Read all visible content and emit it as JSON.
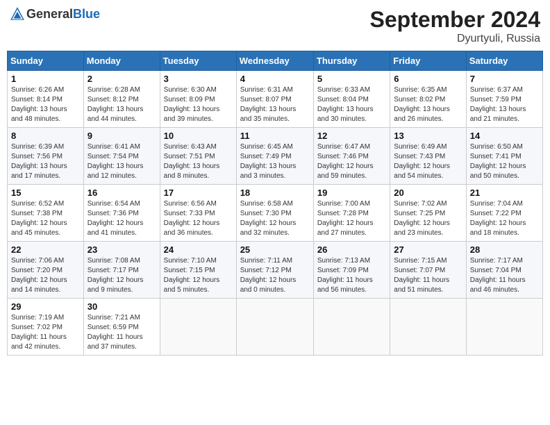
{
  "header": {
    "logo_general": "General",
    "logo_blue": "Blue",
    "month_year": "September 2024",
    "location": "Dyurtyuli, Russia"
  },
  "columns": [
    "Sunday",
    "Monday",
    "Tuesday",
    "Wednesday",
    "Thursday",
    "Friday",
    "Saturday"
  ],
  "weeks": [
    [
      {
        "day": "1",
        "lines": [
          "Sunrise: 6:26 AM",
          "Sunset: 8:14 PM",
          "Daylight: 13 hours",
          "and 48 minutes."
        ]
      },
      {
        "day": "2",
        "lines": [
          "Sunrise: 6:28 AM",
          "Sunset: 8:12 PM",
          "Daylight: 13 hours",
          "and 44 minutes."
        ]
      },
      {
        "day": "3",
        "lines": [
          "Sunrise: 6:30 AM",
          "Sunset: 8:09 PM",
          "Daylight: 13 hours",
          "and 39 minutes."
        ]
      },
      {
        "day": "4",
        "lines": [
          "Sunrise: 6:31 AM",
          "Sunset: 8:07 PM",
          "Daylight: 13 hours",
          "and 35 minutes."
        ]
      },
      {
        "day": "5",
        "lines": [
          "Sunrise: 6:33 AM",
          "Sunset: 8:04 PM",
          "Daylight: 13 hours",
          "and 30 minutes."
        ]
      },
      {
        "day": "6",
        "lines": [
          "Sunrise: 6:35 AM",
          "Sunset: 8:02 PM",
          "Daylight: 13 hours",
          "and 26 minutes."
        ]
      },
      {
        "day": "7",
        "lines": [
          "Sunrise: 6:37 AM",
          "Sunset: 7:59 PM",
          "Daylight: 13 hours",
          "and 21 minutes."
        ]
      }
    ],
    [
      {
        "day": "8",
        "lines": [
          "Sunrise: 6:39 AM",
          "Sunset: 7:56 PM",
          "Daylight: 13 hours",
          "and 17 minutes."
        ]
      },
      {
        "day": "9",
        "lines": [
          "Sunrise: 6:41 AM",
          "Sunset: 7:54 PM",
          "Daylight: 13 hours",
          "and 12 minutes."
        ]
      },
      {
        "day": "10",
        "lines": [
          "Sunrise: 6:43 AM",
          "Sunset: 7:51 PM",
          "Daylight: 13 hours",
          "and 8 minutes."
        ]
      },
      {
        "day": "11",
        "lines": [
          "Sunrise: 6:45 AM",
          "Sunset: 7:49 PM",
          "Daylight: 13 hours",
          "and 3 minutes."
        ]
      },
      {
        "day": "12",
        "lines": [
          "Sunrise: 6:47 AM",
          "Sunset: 7:46 PM",
          "Daylight: 12 hours",
          "and 59 minutes."
        ]
      },
      {
        "day": "13",
        "lines": [
          "Sunrise: 6:49 AM",
          "Sunset: 7:43 PM",
          "Daylight: 12 hours",
          "and 54 minutes."
        ]
      },
      {
        "day": "14",
        "lines": [
          "Sunrise: 6:50 AM",
          "Sunset: 7:41 PM",
          "Daylight: 12 hours",
          "and 50 minutes."
        ]
      }
    ],
    [
      {
        "day": "15",
        "lines": [
          "Sunrise: 6:52 AM",
          "Sunset: 7:38 PM",
          "Daylight: 12 hours",
          "and 45 minutes."
        ]
      },
      {
        "day": "16",
        "lines": [
          "Sunrise: 6:54 AM",
          "Sunset: 7:36 PM",
          "Daylight: 12 hours",
          "and 41 minutes."
        ]
      },
      {
        "day": "17",
        "lines": [
          "Sunrise: 6:56 AM",
          "Sunset: 7:33 PM",
          "Daylight: 12 hours",
          "and 36 minutes."
        ]
      },
      {
        "day": "18",
        "lines": [
          "Sunrise: 6:58 AM",
          "Sunset: 7:30 PM",
          "Daylight: 12 hours",
          "and 32 minutes."
        ]
      },
      {
        "day": "19",
        "lines": [
          "Sunrise: 7:00 AM",
          "Sunset: 7:28 PM",
          "Daylight: 12 hours",
          "and 27 minutes."
        ]
      },
      {
        "day": "20",
        "lines": [
          "Sunrise: 7:02 AM",
          "Sunset: 7:25 PM",
          "Daylight: 12 hours",
          "and 23 minutes."
        ]
      },
      {
        "day": "21",
        "lines": [
          "Sunrise: 7:04 AM",
          "Sunset: 7:22 PM",
          "Daylight: 12 hours",
          "and 18 minutes."
        ]
      }
    ],
    [
      {
        "day": "22",
        "lines": [
          "Sunrise: 7:06 AM",
          "Sunset: 7:20 PM",
          "Daylight: 12 hours",
          "and 14 minutes."
        ]
      },
      {
        "day": "23",
        "lines": [
          "Sunrise: 7:08 AM",
          "Sunset: 7:17 PM",
          "Daylight: 12 hours",
          "and 9 minutes."
        ]
      },
      {
        "day": "24",
        "lines": [
          "Sunrise: 7:10 AM",
          "Sunset: 7:15 PM",
          "Daylight: 12 hours",
          "and 5 minutes."
        ]
      },
      {
        "day": "25",
        "lines": [
          "Sunrise: 7:11 AM",
          "Sunset: 7:12 PM",
          "Daylight: 12 hours",
          "and 0 minutes."
        ]
      },
      {
        "day": "26",
        "lines": [
          "Sunrise: 7:13 AM",
          "Sunset: 7:09 PM",
          "Daylight: 11 hours",
          "and 56 minutes."
        ]
      },
      {
        "day": "27",
        "lines": [
          "Sunrise: 7:15 AM",
          "Sunset: 7:07 PM",
          "Daylight: 11 hours",
          "and 51 minutes."
        ]
      },
      {
        "day": "28",
        "lines": [
          "Sunrise: 7:17 AM",
          "Sunset: 7:04 PM",
          "Daylight: 11 hours",
          "and 46 minutes."
        ]
      }
    ],
    [
      {
        "day": "29",
        "lines": [
          "Sunrise: 7:19 AM",
          "Sunset: 7:02 PM",
          "Daylight: 11 hours",
          "and 42 minutes."
        ]
      },
      {
        "day": "30",
        "lines": [
          "Sunrise: 7:21 AM",
          "Sunset: 6:59 PM",
          "Daylight: 11 hours",
          "and 37 minutes."
        ]
      },
      {
        "day": "",
        "lines": []
      },
      {
        "day": "",
        "lines": []
      },
      {
        "day": "",
        "lines": []
      },
      {
        "day": "",
        "lines": []
      },
      {
        "day": "",
        "lines": []
      }
    ]
  ]
}
